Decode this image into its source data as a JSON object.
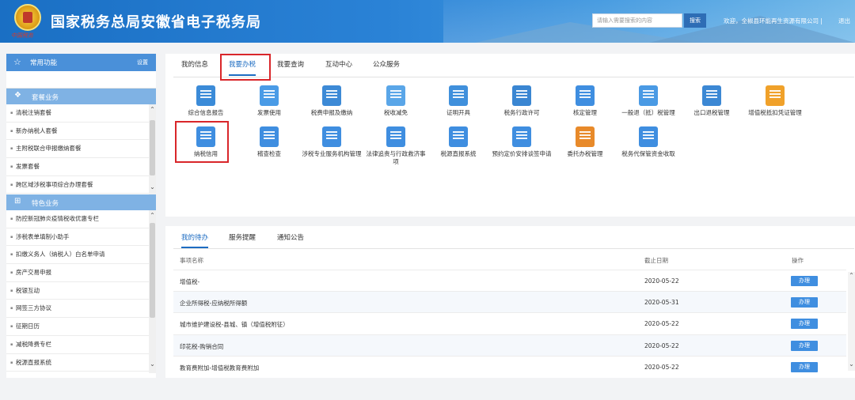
{
  "header": {
    "emblem_text": "中国税务",
    "title": "国家税务总局安徽省电子税务局",
    "search_placeholder": "请输入需要搜索的内容",
    "search_button": "搜索",
    "welcome": "欢迎，全椒县环能再生资源有限公司",
    "separator": "|",
    "logout": "退出"
  },
  "sidebar": {
    "common": {
      "label": "常用功能",
      "settings": "设置"
    },
    "package": {
      "label": "套餐业务",
      "items": [
        "清税注销套餐",
        "新办纳税人套餐",
        "主附税联合申报缴纳套餐",
        "发票套餐",
        "跨区域涉税事项综合办理套餐"
      ]
    },
    "special": {
      "label": "特色业务",
      "items": [
        "防控新冠肺炎疫情税收优惠专栏",
        "涉税表单填制小助手",
        "扣缴义务人（纳税人）白名单申请",
        "房产交易申报",
        "税银互动",
        "网签三方协议",
        "征期日历",
        "减税降费专栏",
        "税源直报系统"
      ]
    }
  },
  "top_tabs": [
    "我的信息",
    "我要办税",
    "我要查询",
    "互动中心",
    "公众服务"
  ],
  "functions_row1": [
    "综合信息报告",
    "发票使用",
    "税费申报及缴纳",
    "税收减免",
    "证明开具",
    "税务行政许可",
    "核定管理",
    "一般退（抵）税管理",
    "出口退税管理",
    "增值税抵扣凭证管理"
  ],
  "functions_row2": [
    "纳税信用",
    "稽查检查",
    "涉税专业服务机构管理",
    "法律追责与行政救济事项",
    "税源直报系统",
    "预约定价安排谈签申请",
    "委托办税管理",
    "税务代保管资金收取"
  ],
  "bottom_tabs": [
    "我的待办",
    "服务提醒",
    "通知公告"
  ],
  "table": {
    "headers": {
      "name": "事项名称",
      "date": "截止日期",
      "action": "操作"
    },
    "rows": [
      {
        "name": "增值税-",
        "date": "2020-05-22",
        "action": "办理"
      },
      {
        "name": "企业所得税-应纳税所得额",
        "date": "2020-05-31",
        "action": "办理"
      },
      {
        "name": "城市维护建设税-县城、镇（增值税附征）",
        "date": "2020-05-22",
        "action": "办理"
      },
      {
        "name": "印花税-购销合同",
        "date": "2020-05-22",
        "action": "办理"
      },
      {
        "name": "教育费附加-增值税教育费附加",
        "date": "2020-05-22",
        "action": "办理"
      }
    ]
  },
  "colors": {
    "accent": "#1d6cc2",
    "highlight_box": "#d9262a",
    "button": "#3f8ee0"
  }
}
